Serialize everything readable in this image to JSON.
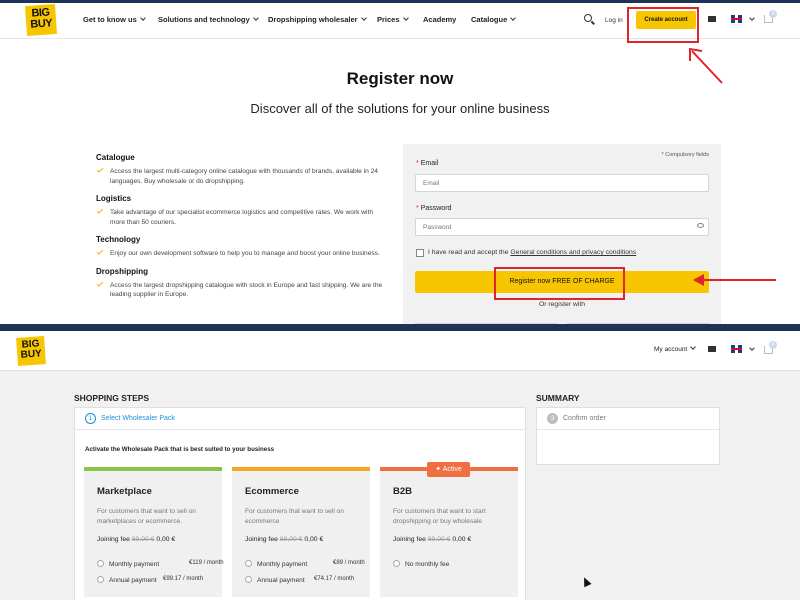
{
  "top": {
    "logo": {
      "line1": "BIG",
      "line2": "BUY"
    },
    "nav": [
      "Get to know us",
      "Solutions and technology",
      "Dropshipping wholesaler",
      "Prices",
      "Academy",
      "Catalogue"
    ],
    "login": "Log in",
    "create_account": "Create account",
    "cart_count": "0",
    "icons": {
      "search": "search-icon",
      "mail": "mail-icon",
      "flag": "uk-flag-icon",
      "cart": "cart-icon",
      "eye": "eye-icon"
    },
    "title": "Register now",
    "subtitle": "Discover all of the solutions for your online business",
    "features": [
      {
        "title": "Catalogue",
        "body": "Access the largest multi-category online catalogue with thousands of brands, available in 24 languages. Buy wholesale or do dropshipping."
      },
      {
        "title": "Logistics",
        "body": "Take advantage of our specialist ecommerce logistics and competitive rates. We work with more than 50 couriers."
      },
      {
        "title": "Technology",
        "body": "Enjoy our own development software to help you to manage and boost your online business."
      },
      {
        "title": "Dropshipping",
        "body": "Access the largest dropshipping catalogue with stock in Europe and fast shipping. We are the leading supplier in Europe."
      }
    ],
    "form": {
      "compulsory": "* Compulsory fields",
      "email_label": "Email",
      "email_placeholder": "Email",
      "password_label": "Password",
      "password_placeholder": "Password",
      "terms_prefix": "I have read and accept the ",
      "terms_link": "General conditions and privacy conditions",
      "submit": "Register now FREE OF CHARGE",
      "or_register": "Or register with",
      "required_mark": "*"
    }
  },
  "bottom": {
    "logo": {
      "line1": "BIG",
      "line2": "BUY"
    },
    "my_account": "My account",
    "cart_count": "0",
    "shopping_steps": "SHOPPING STEPS",
    "summary": "SUMMARY",
    "step1": {
      "num": "1",
      "label": "Select Wholesaler Pack"
    },
    "step3": {
      "num": "3",
      "label": "Confirm order"
    },
    "activate_text": "Activate the Wholesale Pack that is best suited to your business",
    "active_badge": "Active",
    "packs": [
      {
        "title": "Marketplace",
        "desc": "For customers that want to sell on marketplaces or ecommerce.",
        "fee_label": "Joining fee",
        "fee_old": "89,00 €",
        "fee_new": "0,00 €",
        "bar_color": "#8bc34a",
        "options": [
          {
            "label": "Monthly payment",
            "price": "€119 / month"
          },
          {
            "label": "Annual payment",
            "price": "€99.17 / month"
          }
        ]
      },
      {
        "title": "Ecommerce",
        "desc": "For customers that want to sell on ecommerce",
        "fee_label": "Joining fee",
        "fee_old": "89,00 €",
        "fee_new": "0,00 €",
        "bar_color": "#f5a623",
        "options": [
          {
            "label": "Monthly payment",
            "price": "€89 / month"
          },
          {
            "label": "Annual payment",
            "price": "€74.17 / month"
          }
        ]
      },
      {
        "title": "B2B",
        "desc": "For customers that want to start dropshipping or buy wholesale",
        "fee_label": "Joining fee",
        "fee_old": "89,00 €",
        "fee_new": "0,00 €",
        "bar_color": "#ef6e42",
        "options": [
          {
            "label": "No monthly fee",
            "price": ""
          }
        ]
      }
    ]
  },
  "colors": {
    "brand_yellow": "#f7c600",
    "navy": "#1d3456",
    "accent_blue": "#1b8fd8",
    "annotation_red": "#e0242b"
  }
}
